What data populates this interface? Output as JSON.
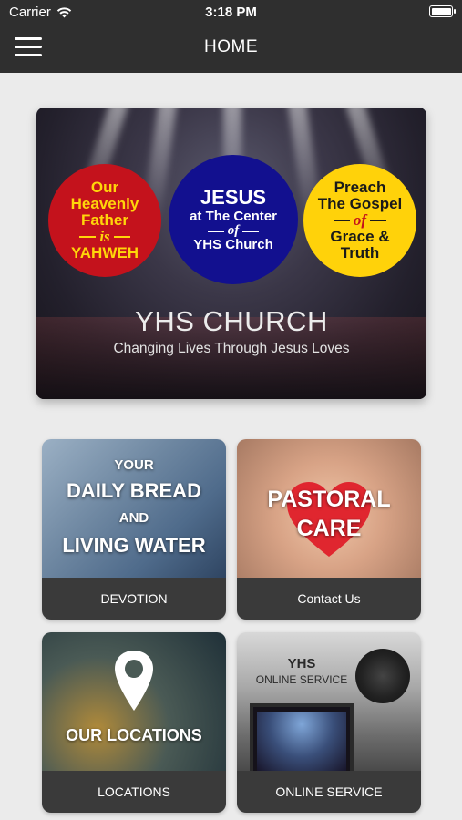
{
  "status_bar": {
    "carrier": "Carrier",
    "time": "3:18 PM",
    "icons": [
      "wifi-icon",
      "battery-icon"
    ]
  },
  "nav": {
    "title": "HOME",
    "menu_icon": "hamburger-menu-icon"
  },
  "hero": {
    "left_circle": {
      "line1": "Our",
      "line2": "Heavenly",
      "line3": "Father",
      "line4": "is",
      "line5": "YAHWEH"
    },
    "center_circle": {
      "line1": "JESUS",
      "line2": "at The Center",
      "line3": "of",
      "line4": "YHS Church"
    },
    "right_circle": {
      "line1": "Preach",
      "line2": "The Gospel",
      "line3": "of",
      "line4": "Grace &",
      "line5": "Truth"
    },
    "church_name": "YHS CHURCH",
    "tagline": "Changing Lives Through Jesus Loves",
    "colors": {
      "red": "#c4121c",
      "blue": "#12108f",
      "yellow": "#ffd20a"
    }
  },
  "tiles": [
    {
      "label": "DEVOTION",
      "overlay": [
        "YOUR",
        "DAILY BREAD",
        "AND",
        "LIVING WATER"
      ]
    },
    {
      "label": "Contact Us",
      "overlay": [
        "PASTORAL",
        "CARE"
      ]
    },
    {
      "label": "LOCATIONS",
      "overlay": [
        "OUR LOCATIONS"
      ]
    },
    {
      "label": "ONLINE SERVICE",
      "overlay": [
        "YHS",
        "ONLINE SERVICE"
      ]
    }
  ]
}
